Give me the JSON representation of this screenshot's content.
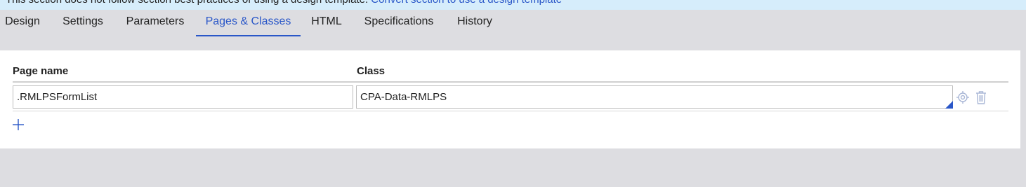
{
  "banner": {
    "text": "This section does not follow section best practices of using a design template.",
    "link": "Convert section to use a design template"
  },
  "tabs": [
    {
      "label": "Design"
    },
    {
      "label": "Settings"
    },
    {
      "label": "Parameters"
    },
    {
      "label": "Pages & Classes",
      "active": true
    },
    {
      "label": "HTML"
    },
    {
      "label": "Specifications"
    },
    {
      "label": "History"
    }
  ],
  "table": {
    "headers": {
      "page_name": "Page name",
      "class": "Class"
    },
    "rows": [
      {
        "page_name": ".RMLPSFormList",
        "class": "CPA-Data-RMLPS"
      }
    ]
  },
  "icons": {
    "open_class": "target-icon",
    "delete_row": "trash-icon",
    "add_row": "plus-icon"
  },
  "colors": {
    "accent": "#2a57c8",
    "banner_bg": "#d6edfb",
    "page_bg": "#dddde1",
    "panel_bg": "#ffffff"
  }
}
